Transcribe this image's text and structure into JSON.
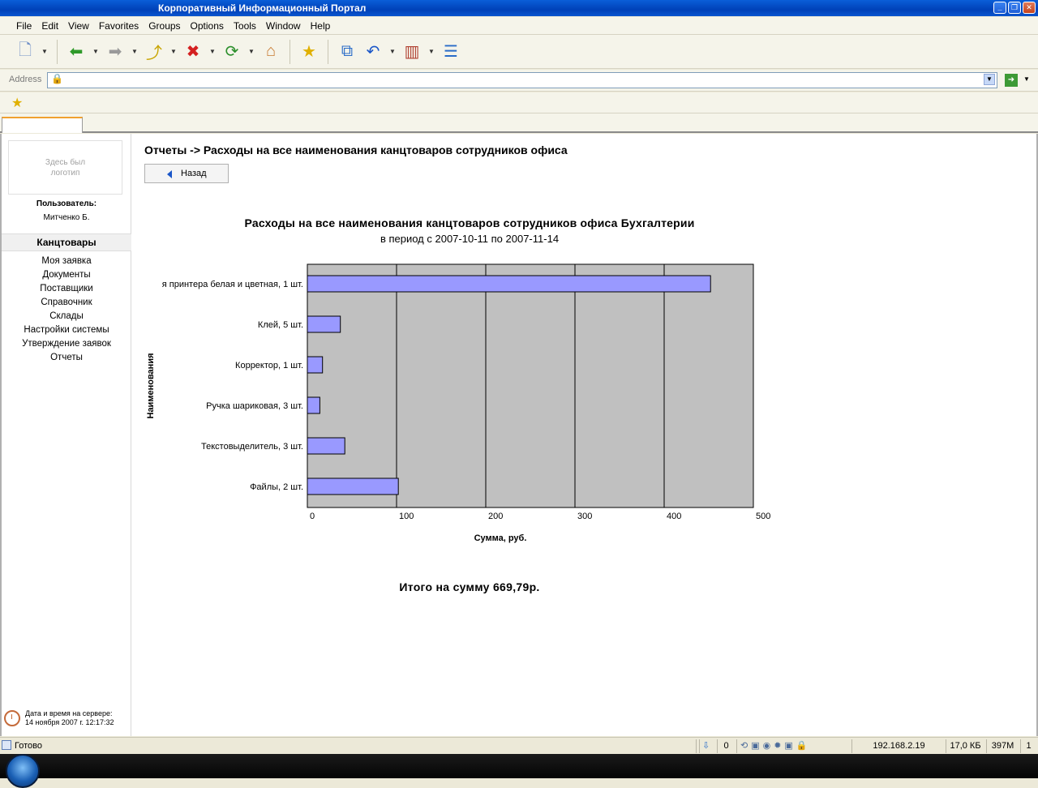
{
  "window": {
    "title": "Корпоративный Информационный Портал"
  },
  "menubar": {
    "items": [
      "File",
      "Edit",
      "View",
      "Favorites",
      "Groups",
      "Options",
      "Tools",
      "Window",
      "Help"
    ]
  },
  "addressbar": {
    "label": "Address",
    "url": ""
  },
  "sidebar": {
    "logo_text": "Здесь был логотип",
    "user_label": "Пользователь:",
    "user_name": "Митченко Б.",
    "section_title": "Канцтовары",
    "items": [
      "Моя заявка",
      "Документы",
      "Поставщики",
      "Справочник",
      "Склады",
      "Настройки системы",
      "Утверждение заявок",
      "Отчеты"
    ],
    "server_time_label": "Дата и время на сервере:",
    "server_time_value": "14 ноября 2007 г. 12:17:32"
  },
  "main": {
    "page_title": "Отчеты -> Расходы на все наименования канцтоваров сотрудников офиса",
    "back_button": "Назад",
    "total": "Итого на сумму 669,79р."
  },
  "chart_data": {
    "type": "bar",
    "orientation": "horizontal",
    "title": "Расходы на все наименования канцтоваров сотрудников офиса Бухгалтерии",
    "subtitle": "в период с 2007-10-11 по 2007-11-14",
    "xlabel": "Сумма, руб.",
    "ylabel": "Наименования",
    "categories": [
      "я принтера белая и цветная, 1 шт.",
      "Клей, 5 шт.",
      "Корректор, 1 шт.",
      "Ручка шариковая, 3 шт.",
      "Текстовыделитель, 3 шт.",
      "Файлы, 2 шт."
    ],
    "values": [
      452,
      37,
      17,
      14,
      42,
      102
    ],
    "xlim": [
      0,
      500
    ],
    "xticks": [
      0,
      100,
      200,
      300,
      400,
      500
    ],
    "grid": true,
    "colors": {
      "bar": "#9999ff",
      "plot_bg": "#c0c0c0"
    }
  },
  "statusbar": {
    "text": "Готово",
    "counter": "0",
    "ip": "192.168.2.19",
    "size": "17,0 КБ",
    "memory": "397M",
    "page": "1"
  }
}
